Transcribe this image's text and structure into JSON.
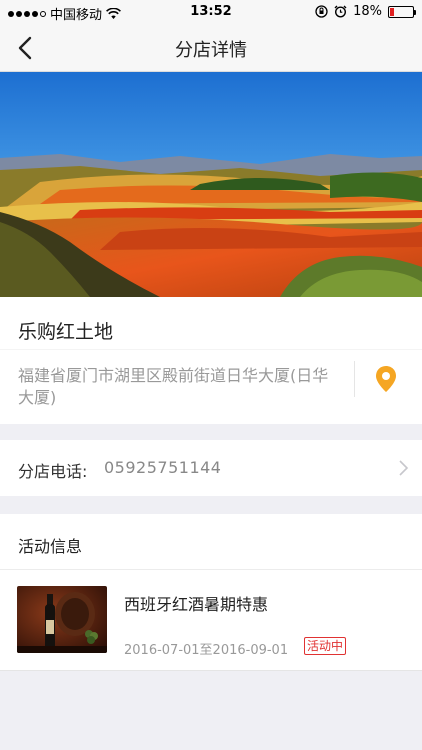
{
  "status_bar": {
    "carrier": "中国移动",
    "time": "13:52",
    "battery": "18%",
    "battery_level": 0.18
  },
  "nav": {
    "title": "分店详情",
    "back_icon": "chevron-left-icon"
  },
  "shop": {
    "name": "乐购红土地",
    "address": "福建省厦门市湖里区殿前街道日华大厦(日华大厦)",
    "location_icon": "map-pin-icon"
  },
  "phone": {
    "label": "分店电话:",
    "value": "05925751144"
  },
  "activity": {
    "section_title": "活动信息",
    "items": [
      {
        "title": "西班牙红酒暑期特惠",
        "date_range": "2016-07-01至2016-09-01",
        "status": "活动中"
      }
    ]
  },
  "colors": {
    "accent": "#f5a623",
    "status_red": "#e03232",
    "background": "#efeff4"
  }
}
